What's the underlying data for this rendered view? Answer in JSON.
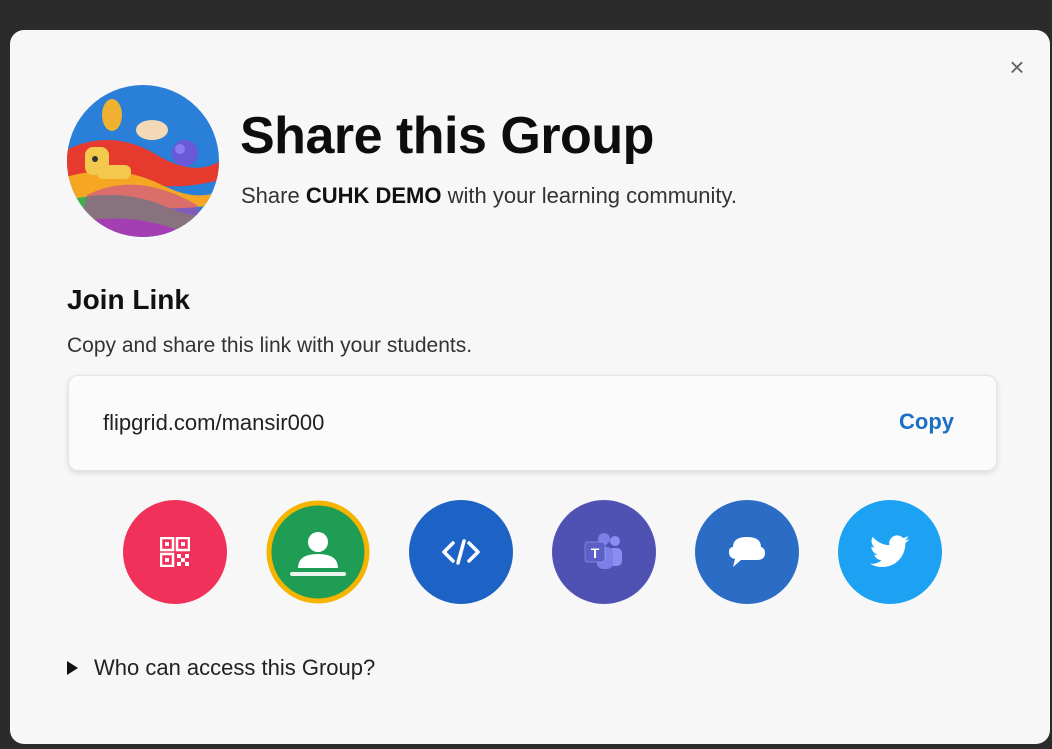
{
  "dialog": {
    "close_glyph": "×",
    "title": "Share this Group",
    "subtitle_prefix": "Share ",
    "group_name": "CUHK DEMO",
    "subtitle_suffix": " with your learning community."
  },
  "join_link": {
    "heading": "Join Link",
    "description": "Copy and share this link with your students.",
    "url": "flipgrid.com/mansir000",
    "copy_label": "Copy"
  },
  "share_options": [
    {
      "name": "qr-code",
      "icon": "qr-code-icon",
      "color": "#f0325a"
    },
    {
      "name": "google-classroom",
      "icon": "google-classroom-icon",
      "color": "#1f9d55",
      "ring": "#f5b400"
    },
    {
      "name": "embed",
      "icon": "embed-code-icon",
      "color": "#1d63c6"
    },
    {
      "name": "microsoft-teams",
      "icon": "microsoft-teams-icon",
      "color": "#4f52b2"
    },
    {
      "name": "remind",
      "icon": "remind-icon",
      "color": "#2b6cc4"
    },
    {
      "name": "twitter",
      "icon": "twitter-icon",
      "color": "#1da1f2"
    }
  ],
  "access_toggle": {
    "label": "Who can access this Group?"
  }
}
